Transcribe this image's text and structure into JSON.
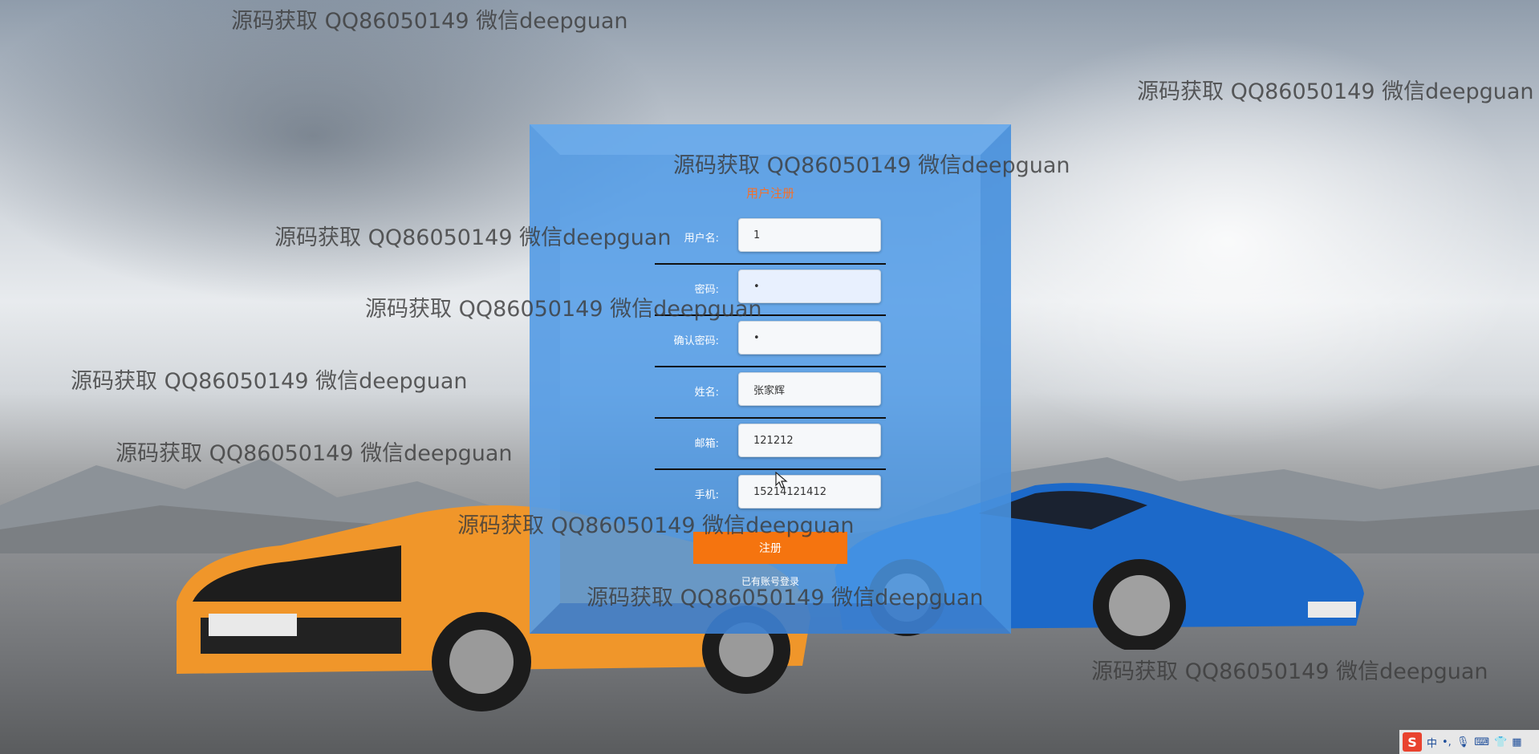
{
  "form": {
    "title": "用户注册",
    "fields": [
      {
        "label": "用户名:",
        "value": "1",
        "type": "text"
      },
      {
        "label": "密码:",
        "value": "•",
        "type": "text"
      },
      {
        "label": "确认密码:",
        "value": "•",
        "type": "text"
      },
      {
        "label": "姓名:",
        "value": "张家辉",
        "type": "text"
      },
      {
        "label": "邮箱:",
        "value": "121212",
        "type": "text"
      },
      {
        "label": "手机:",
        "value": "15214121412",
        "type": "text"
      }
    ],
    "submit_label": "注册",
    "login_link": "已有账号登录"
  },
  "watermark": {
    "text": "源码获取 QQ86050149 微信deepguan",
    "count": 10
  },
  "ime_toolbar": {
    "logo": "S",
    "mode": "中",
    "punct": "•,",
    "icons": [
      "microphone-icon",
      "keyboard-icon",
      "shirt-icon",
      "grid-icon"
    ]
  },
  "colors": {
    "panel": "#4a98e8",
    "title": "#f3702a",
    "button": "#f5740f",
    "watermark": "#3c3c3c"
  }
}
